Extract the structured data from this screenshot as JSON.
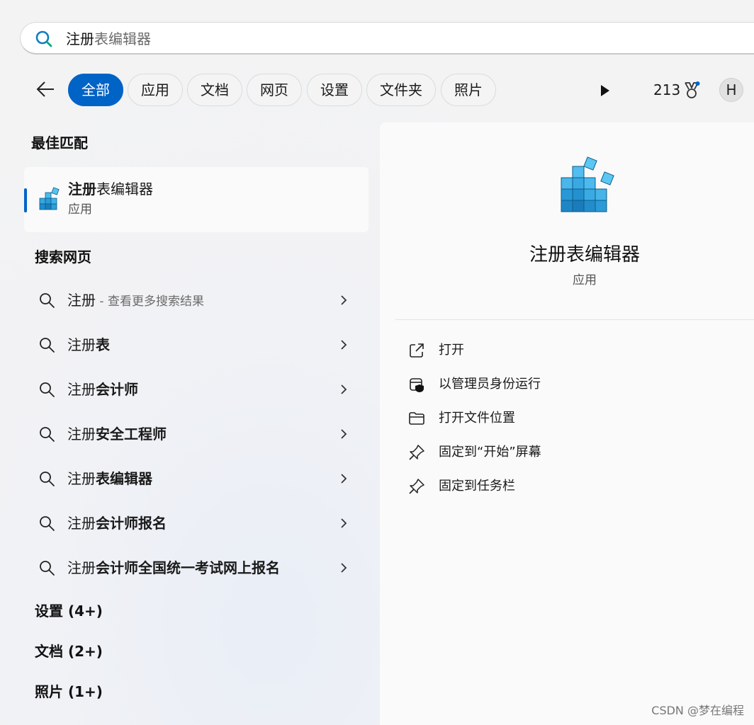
{
  "search": {
    "query_strong": "注册",
    "query_rest": "表编辑器"
  },
  "filters": {
    "tabs": [
      {
        "label": "全部",
        "active": true
      },
      {
        "label": "应用",
        "active": false
      },
      {
        "label": "文档",
        "active": false
      },
      {
        "label": "网页",
        "active": false
      },
      {
        "label": "设置",
        "active": false
      },
      {
        "label": "文件夹",
        "active": false
      },
      {
        "label": "照片",
        "active": false
      }
    ],
    "points": "213",
    "avatar_initial": "H",
    "icons": {
      "back": "back-arrow-icon",
      "more": "play-icon",
      "rewards": "medal-icon"
    }
  },
  "best_match": {
    "title": "最佳匹配",
    "name_strong": "注册",
    "name_rest": "表编辑器",
    "type": "应用",
    "icon": "registry-editor-icon"
  },
  "web": {
    "title": "搜索网页",
    "items": [
      {
        "prefix": "注册",
        "strong": "",
        "hint": " - 查看更多搜索结果"
      },
      {
        "prefix": "注册",
        "strong": "表",
        "hint": ""
      },
      {
        "prefix": "注册",
        "strong": "会计师",
        "hint": ""
      },
      {
        "prefix": "注册",
        "strong": "安全工程师",
        "hint": ""
      },
      {
        "prefix": "注册",
        "strong": "表编辑器",
        "hint": ""
      },
      {
        "prefix": "注册",
        "strong": "会计师报名",
        "hint": ""
      },
      {
        "prefix": "注册",
        "strong": "会计师全国统一考试网上报名",
        "hint": ""
      }
    ]
  },
  "categories": [
    {
      "label": "设置 (4+)"
    },
    {
      "label": "文档 (2+)"
    },
    {
      "label": "照片 (1+)"
    }
  ],
  "detail": {
    "name": "注册表编辑器",
    "type": "应用",
    "actions": [
      {
        "label": "打开",
        "icon": "open-external-icon"
      },
      {
        "label": "以管理员身份运行",
        "icon": "shield-admin-icon"
      },
      {
        "label": "打开文件位置",
        "icon": "folder-icon"
      },
      {
        "label": "固定到“开始”屏幕",
        "icon": "pin-icon"
      },
      {
        "label": "固定到任务栏",
        "icon": "pin-icon"
      }
    ]
  },
  "watermark": "CSDN @梦在编程",
  "colors": {
    "accent": "#0063c6",
    "search_icon": "#0f7fbf"
  }
}
